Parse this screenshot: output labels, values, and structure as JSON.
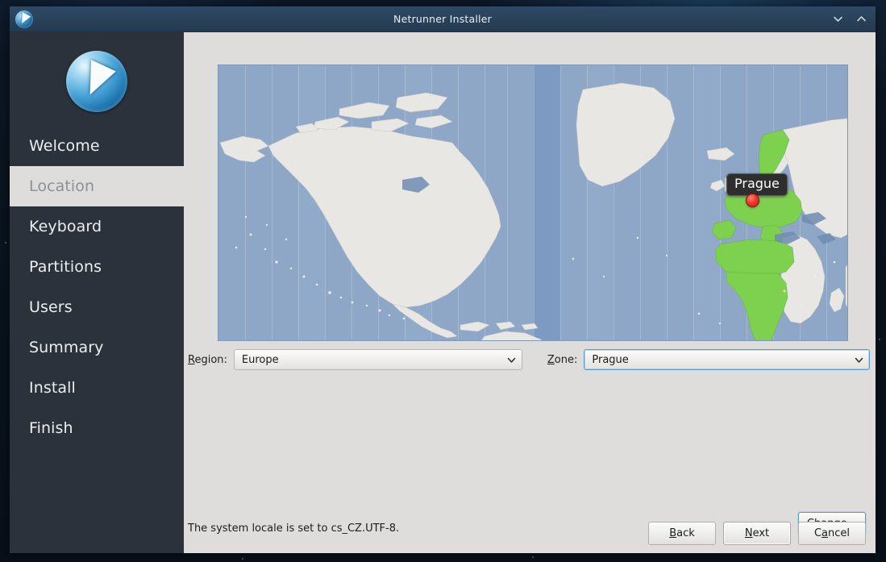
{
  "window": {
    "title": "Netrunner Installer",
    "app_icon": "netrunner-compass-icon",
    "controls": [
      {
        "name": "chevron-down-icon",
        "glyph": "v"
      },
      {
        "name": "chevron-up-icon",
        "glyph": "^"
      }
    ]
  },
  "sidebar": {
    "logo_icon": "netrunner-logo-icon",
    "items": [
      {
        "label": "Welcome",
        "active": false
      },
      {
        "label": "Location",
        "active": true
      },
      {
        "label": "Keyboard",
        "active": false
      },
      {
        "label": "Partitions",
        "active": false
      },
      {
        "label": "Users",
        "active": false
      },
      {
        "label": "Summary",
        "active": false
      },
      {
        "label": "Install",
        "active": false
      },
      {
        "label": "Finish",
        "active": false
      }
    ]
  },
  "map": {
    "tooltip_label": "Prague",
    "marker_name": "location-marker",
    "ocean_color": "#8ea7c7",
    "land_color": "#e8e7e4",
    "highlight_color": "#7ed04f",
    "marker_color": "#f03b2e"
  },
  "selectors": {
    "region": {
      "label_pre": "R",
      "label_post": "egion:",
      "value": "Europe",
      "focused": false
    },
    "zone": {
      "label_pre": "Z",
      "label_post": "one:",
      "value": "Prague",
      "focused": true
    }
  },
  "locale": {
    "text": "The system locale is set to cs_CZ.UTF-8.",
    "change_pre": "C",
    "change_post": "hange..."
  },
  "buttons": [
    {
      "pre": "B",
      "post": "ack",
      "name": "back-button",
      "default": false
    },
    {
      "pre": "N",
      "post": "ext",
      "name": "next-button",
      "default": true
    },
    {
      "pre": "Ca",
      "post": "ncel",
      "name": "cancel-button",
      "default": false,
      "split": true
    }
  ]
}
